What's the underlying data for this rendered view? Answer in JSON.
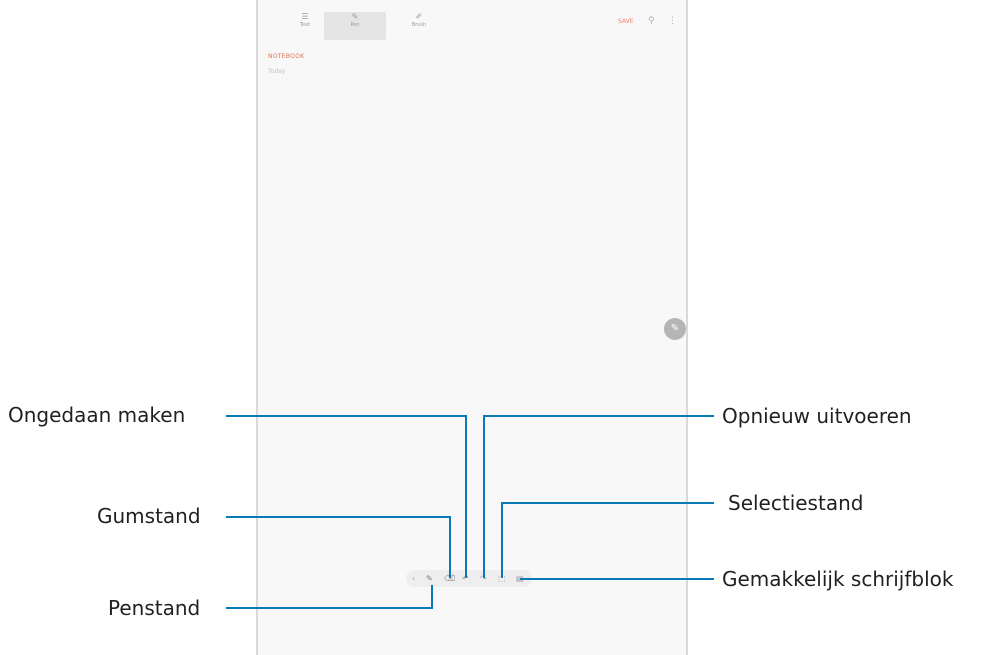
{
  "toolbar": {
    "tabs": [
      {
        "label": "Text",
        "icon": "text-icon"
      },
      {
        "label": "Pen",
        "icon": "pen-icon"
      },
      {
        "label": "Brush",
        "icon": "brush-icon"
      }
    ],
    "save_label": "SAVE"
  },
  "note": {
    "title": "NOTEBOOK",
    "body": "Today"
  },
  "callouts": {
    "undo": "Ongedaan maken",
    "redo": "Opnieuw uitvoeren",
    "eraser": "Gumstand",
    "selection": "Selectiestand",
    "pen": "Penstand",
    "easy_writing": "Gemakkelijk schrijfblok"
  },
  "colors": {
    "callout_line": "#0a7ab7",
    "accent": "#e5714f"
  }
}
